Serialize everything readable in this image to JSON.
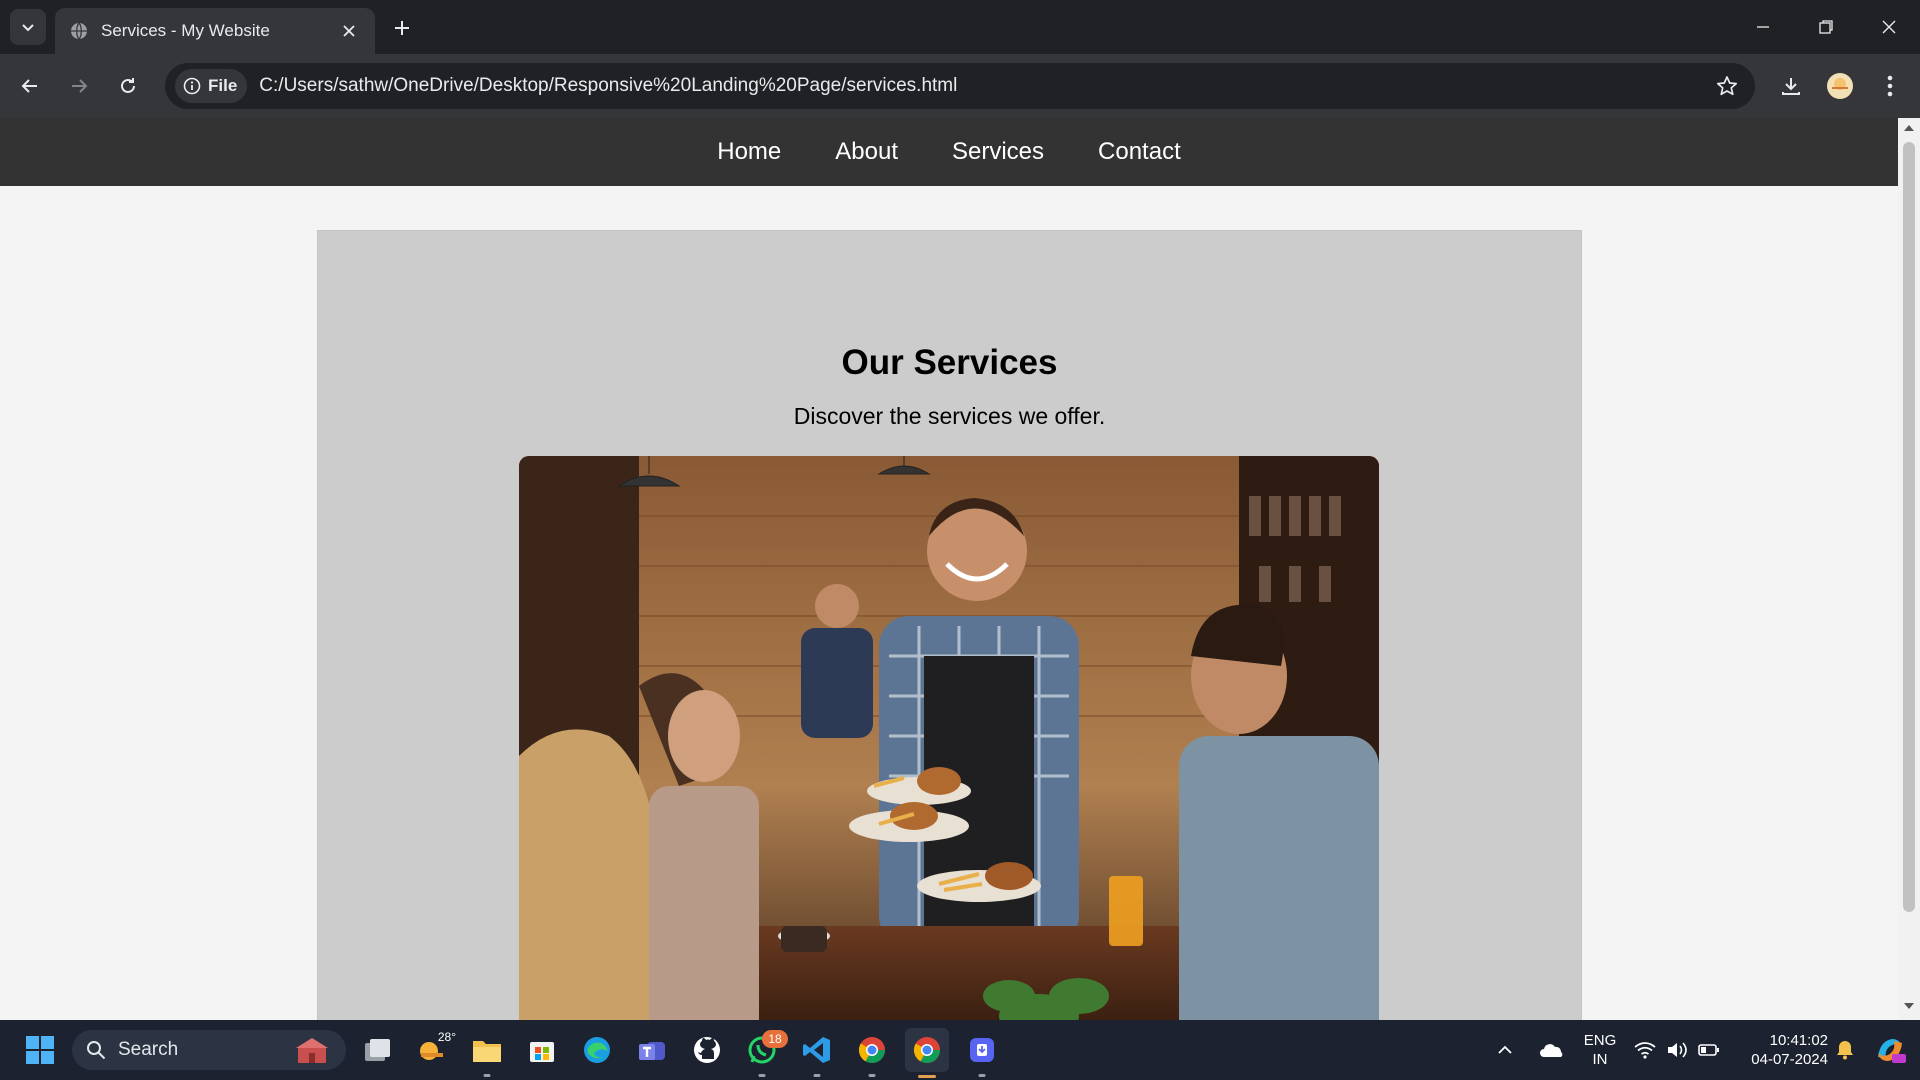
{
  "browser": {
    "tab": {
      "title": "Services - My Website",
      "favicon": "globe-icon"
    },
    "omnibox": {
      "chip_label": "File",
      "url": "C:/Users/sathw/OneDrive/Desktop/Responsive%20Landing%20Page/services.html"
    }
  },
  "site": {
    "nav": [
      "Home",
      "About",
      "Services",
      "Contact"
    ],
    "title": "Our Services",
    "subtitle": "Discover the services we offer.",
    "hero_image": "restaurant waiter serving burgers and fries to smiling guests"
  },
  "taskbar": {
    "search_label": "Search",
    "weather_temp": "28°",
    "whatsapp_badge": "18",
    "lang_line1": "ENG",
    "lang_line2": "IN",
    "time": "10:41:02",
    "date": "04-07-2024"
  },
  "colors": {
    "chrome_dark": "#202124",
    "chrome_toolbar": "#35363a",
    "site_nav_bg": "#333333",
    "card_bg": "#cccccc",
    "page_bg": "#f4f4f4",
    "taskbar_bg": "#1c2230"
  }
}
